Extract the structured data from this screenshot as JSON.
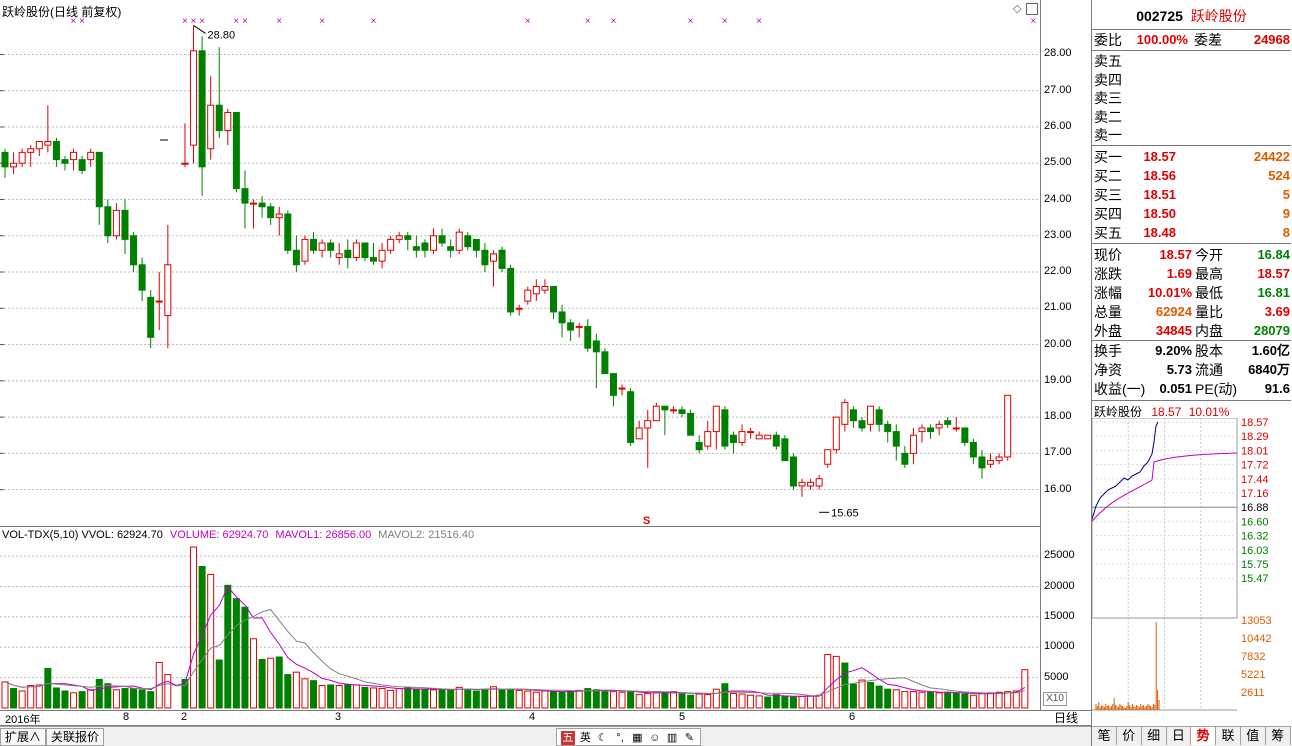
{
  "kline": {
    "title": "跃岭股份(日线 前复权)",
    "high_label": "28.80",
    "low_label": "15.65",
    "s_marker": "S",
    "price_ticks": [
      "28.00",
      "27.00",
      "26.00",
      "25.00",
      "24.00",
      "23.00",
      "22.00",
      "21.00",
      "20.00",
      "19.00",
      "18.00",
      "17.00",
      "16.00"
    ],
    "axis_min": 15.3,
    "axis_max": 28.95,
    "candles": [
      [
        25.3,
        25.4,
        24.6,
        24.9
      ],
      [
        24.9,
        25.3,
        24.7,
        25.0
      ],
      [
        25.0,
        25.4,
        24.9,
        25.3
      ],
      [
        25.3,
        25.5,
        24.9,
        25.4
      ],
      [
        25.4,
        25.6,
        25.2,
        25.6
      ],
      [
        25.5,
        26.6,
        25.3,
        25.6
      ],
      [
        25.6,
        25.7,
        24.9,
        25.1
      ],
      [
        25.1,
        25.2,
        24.8,
        25.0
      ],
      [
        25.1,
        25.4,
        24.8,
        25.3
      ],
      [
        25.1,
        25.2,
        24.7,
        24.8
      ],
      [
        25.1,
        25.4,
        24.9,
        25.3
      ],
      [
        25.3,
        25.3,
        23.3,
        23.8
      ],
      [
        23.8,
        24.0,
        22.8,
        23.0
      ],
      [
        23.0,
        23.9,
        22.9,
        23.7
      ],
      [
        23.7,
        24.0,
        22.5,
        22.9
      ],
      [
        23.0,
        23.1,
        22.0,
        22.2
      ],
      [
        22.2,
        22.4,
        21.2,
        21.5
      ],
      [
        21.3,
        21.5,
        19.9,
        20.2
      ],
      [
        21.2,
        22.0,
        20.4,
        21.2
      ],
      [
        20.8,
        23.3,
        19.9,
        22.2
      ],
      [
        null,
        null,
        null,
        null
      ],
      [
        25.0,
        26.1,
        24.9,
        25.0
      ],
      [
        25.5,
        28.8,
        25.0,
        28.1
      ],
      [
        28.1,
        28.5,
        24.1,
        24.9
      ],
      [
        25.4,
        27.4,
        25.1,
        26.6
      ],
      [
        26.6,
        28.2,
        25.7,
        25.9
      ],
      [
        25.9,
        26.5,
        25.5,
        26.4
      ],
      [
        26.4,
        26.4,
        24.2,
        24.3
      ],
      [
        24.3,
        24.8,
        23.2,
        23.9
      ],
      [
        23.9,
        24.0,
        23.2,
        23.9
      ],
      [
        23.9,
        24.1,
        23.5,
        23.8
      ],
      [
        23.8,
        23.9,
        23.3,
        23.5
      ],
      [
        23.5,
        23.8,
        23.0,
        23.6
      ],
      [
        23.6,
        23.7,
        22.5,
        22.6
      ],
      [
        22.6,
        23.0,
        22.0,
        22.2
      ],
      [
        22.3,
        23.0,
        22.2,
        22.9
      ],
      [
        22.9,
        23.1,
        22.5,
        22.6
      ],
      [
        22.6,
        22.9,
        22.4,
        22.8
      ],
      [
        22.8,
        22.9,
        22.4,
        22.6
      ],
      [
        22.4,
        22.8,
        22.2,
        22.5
      ],
      [
        22.6,
        22.9,
        22.1,
        22.4
      ],
      [
        22.4,
        22.9,
        22.3,
        22.8
      ],
      [
        22.8,
        22.8,
        22.3,
        22.4
      ],
      [
        22.4,
        22.8,
        22.2,
        22.3
      ],
      [
        22.3,
        22.8,
        22.1,
        22.6
      ],
      [
        22.6,
        23.0,
        22.5,
        22.9
      ],
      [
        22.9,
        23.1,
        22.8,
        23.0
      ],
      [
        23.0,
        23.1,
        22.6,
        22.9
      ],
      [
        22.7,
        23.0,
        22.4,
        22.6
      ],
      [
        22.8,
        22.9,
        22.4,
        22.6
      ],
      [
        22.6,
        23.2,
        22.5,
        23.0
      ],
      [
        23.0,
        23.2,
        22.7,
        22.8
      ],
      [
        22.7,
        22.9,
        22.4,
        22.6
      ],
      [
        22.6,
        23.2,
        22.5,
        23.1
      ],
      [
        23.0,
        23.1,
        22.6,
        22.7
      ],
      [
        22.9,
        22.9,
        22.4,
        22.6
      ],
      [
        22.6,
        22.8,
        22.0,
        22.2
      ],
      [
        22.3,
        22.6,
        21.6,
        22.5
      ],
      [
        22.6,
        22.7,
        22.0,
        22.1
      ],
      [
        22.1,
        22.2,
        20.8,
        20.9
      ],
      [
        21.0,
        21.1,
        20.8,
        21.0
      ],
      [
        21.2,
        21.6,
        21.1,
        21.5
      ],
      [
        21.4,
        21.8,
        21.2,
        21.6
      ],
      [
        21.5,
        21.8,
        21.4,
        21.6
      ],
      [
        21.6,
        21.6,
        20.7,
        20.9
      ],
      [
        20.9,
        21.1,
        20.2,
        20.6
      ],
      [
        20.6,
        20.7,
        20.1,
        20.4
      ],
      [
        20.5,
        20.6,
        20.2,
        20.5
      ],
      [
        20.5,
        20.7,
        19.8,
        19.9
      ],
      [
        20.1,
        20.3,
        18.8,
        19.8
      ],
      [
        19.8,
        19.9,
        19.2,
        19.2
      ],
      [
        19.2,
        19.2,
        18.3,
        18.6
      ],
      [
        18.8,
        18.9,
        18.6,
        18.8
      ],
      [
        18.7,
        18.8,
        17.2,
        17.3
      ],
      [
        17.4,
        17.9,
        17.4,
        17.7
      ],
      [
        17.7,
        18.2,
        16.6,
        17.9
      ],
      [
        17.9,
        18.4,
        17.9,
        18.3
      ],
      [
        18.3,
        18.3,
        17.5,
        18.2
      ],
      [
        18.2,
        18.3,
        18.1,
        18.2
      ],
      [
        18.2,
        18.3,
        18.0,
        18.1
      ],
      [
        18.1,
        18.2,
        17.5,
        17.5
      ],
      [
        17.3,
        17.5,
        17.0,
        17.1
      ],
      [
        17.2,
        17.9,
        17.1,
        17.6
      ],
      [
        17.6,
        18.3,
        17.1,
        18.3
      ],
      [
        18.2,
        18.3,
        17.1,
        17.2
      ],
      [
        17.5,
        17.6,
        17.0,
        17.3
      ],
      [
        17.3,
        17.8,
        17.2,
        17.6
      ],
      [
        17.6,
        17.7,
        17.4,
        17.6
      ],
      [
        17.4,
        17.6,
        17.4,
        17.5
      ],
      [
        17.4,
        17.5,
        17.4,
        17.5
      ],
      [
        17.5,
        17.6,
        17.1,
        17.2
      ],
      [
        17.4,
        17.5,
        16.8,
        16.8
      ],
      [
        16.9,
        17.0,
        16.0,
        16.1
      ],
      [
        16.1,
        16.3,
        15.8,
        16.2
      ],
      [
        16.1,
        16.3,
        16.0,
        16.2
      ],
      [
        16.1,
        16.4,
        16.0,
        16.3
      ],
      [
        16.7,
        17.1,
        16.6,
        17.1
      ],
      [
        17.1,
        18.0,
        17.0,
        18.0
      ],
      [
        17.8,
        18.5,
        17.6,
        18.4
      ],
      [
        18.2,
        18.3,
        17.7,
        17.9
      ],
      [
        17.9,
        18.0,
        17.6,
        17.7
      ],
      [
        17.8,
        18.3,
        17.6,
        18.3
      ],
      [
        18.2,
        18.3,
        17.6,
        17.8
      ],
      [
        17.8,
        17.9,
        17.3,
        17.6
      ],
      [
        17.6,
        17.8,
        16.8,
        17.2
      ],
      [
        17.0,
        17.2,
        16.6,
        16.7
      ],
      [
        17.0,
        17.7,
        16.7,
        17.5
      ],
      [
        17.6,
        17.8,
        17.3,
        17.7
      ],
      [
        17.7,
        17.8,
        17.4,
        17.6
      ],
      [
        17.7,
        17.9,
        17.5,
        17.8
      ],
      [
        17.9,
        18.0,
        17.7,
        17.8
      ],
      [
        17.7,
        18.0,
        17.6,
        17.7
      ],
      [
        17.7,
        17.7,
        17.2,
        17.3
      ],
      [
        17.3,
        17.4,
        16.7,
        16.9
      ],
      [
        16.9,
        17.1,
        16.3,
        16.6
      ],
      [
        16.7,
        17.0,
        16.6,
        16.8
      ],
      [
        16.8,
        17.0,
        16.7,
        16.9
      ],
      [
        16.9,
        18.6,
        16.8,
        18.6
      ]
    ],
    "marker_indices": [
      8,
      9,
      21,
      22,
      23,
      27,
      28,
      32,
      37,
      43,
      61,
      68,
      71,
      80,
      84,
      88,
      120
    ]
  },
  "volume": {
    "label_main": "VOL-TDX(5,10)",
    "label_vvol": "VVOL: 62924.70",
    "label_volume": "VOLUME: 62924.70",
    "label_mavol1": "MAVOL1: 26856.00",
    "label_mavol2": "MAVOL2: 21516.40",
    "ticks": [
      "25000",
      "20000",
      "15000",
      "10000",
      "5000"
    ],
    "x10_label": "X10",
    "axis_max": 27500,
    "values": [
      4300,
      3200,
      2800,
      3700,
      3800,
      6500,
      3300,
      2800,
      2500,
      2700,
      3000,
      4700,
      4000,
      3000,
      3200,
      3200,
      3000,
      2700,
      7500,
      5500,
      0,
      4700,
      26500,
      23300,
      22000,
      7900,
      20200,
      18000,
      16600,
      11400,
      8000,
      8200,
      8400,
      5500,
      5900,
      4800,
      4500,
      3700,
      3800,
      3700,
      3900,
      3800,
      3400,
      3300,
      3200,
      2900,
      3200,
      3300,
      3100,
      3100,
      3000,
      3000,
      2900,
      3400,
      3100,
      2800,
      3100,
      3500,
      3000,
      3100,
      2900,
      2800,
      2600,
      2800,
      2700,
      2600,
      2800,
      2900,
      3200,
      3000,
      2800,
      2700,
      2600,
      2800,
      2200,
      2400,
      2500,
      2600,
      2700,
      2300,
      2100,
      2300,
      2200,
      3100,
      4000,
      2400,
      2300,
      2100,
      2000,
      1800,
      2200,
      1900,
      1800,
      1900,
      2000,
      2100,
      8800,
      8500,
      7400,
      3900,
      4600,
      4200,
      3600,
      3100,
      3000,
      2700,
      2700,
      2600,
      2600,
      2500,
      2600,
      2400,
      2300,
      2100,
      2400,
      2500,
      2600,
      2700,
      2800,
      6300
    ],
    "colors_up": [
      1,
      0,
      1,
      1,
      1,
      0,
      0,
      0,
      1,
      0,
      1,
      0,
      0,
      1,
      0,
      0,
      0,
      0,
      1,
      1,
      0,
      0,
      1,
      0,
      1,
      0,
      0,
      0,
      0,
      1,
      0,
      1,
      0,
      0,
      1,
      1,
      0,
      1,
      0,
      1,
      0,
      1,
      0,
      1,
      1,
      1,
      1,
      0,
      0,
      0,
      1,
      0,
      0,
      1,
      0,
      0,
      0,
      1,
      0,
      0,
      1,
      1,
      1,
      1,
      0,
      0,
      0,
      1,
      0,
      0,
      0,
      1,
      1,
      0,
      1,
      1,
      1,
      0,
      1,
      0,
      0,
      1,
      1,
      1,
      0,
      1,
      1,
      1,
      1,
      0,
      0,
      0,
      0,
      1,
      1,
      1,
      1,
      1,
      0,
      0,
      1,
      0,
      0,
      0,
      1,
      1,
      1,
      1,
      0,
      1,
      0,
      0,
      0,
      1,
      1,
      1,
      1,
      1,
      1,
      1,
      1
    ]
  },
  "dates": [
    "2016年",
    "8",
    "2",
    "3",
    "4",
    "5",
    "6"
  ],
  "bottom_tabs": [
    "扩展∧",
    "关联报价"
  ],
  "right": {
    "code": "002725",
    "name": "跃岭股份",
    "weibi_label": "委比",
    "weibi": "100.00%",
    "weicha_label": "委差",
    "weicha": "24968",
    "asks": [
      {
        "label": "卖五"
      },
      {
        "label": "卖四"
      },
      {
        "label": "卖三"
      },
      {
        "label": "卖二"
      },
      {
        "label": "卖一"
      }
    ],
    "bids": [
      {
        "label": "买一",
        "price": "18.57",
        "vol": "24422"
      },
      {
        "label": "买二",
        "price": "18.56",
        "vol": "524"
      },
      {
        "label": "买三",
        "price": "18.51",
        "vol": "5"
      },
      {
        "label": "买四",
        "price": "18.50",
        "vol": "9"
      },
      {
        "label": "买五",
        "price": "18.48",
        "vol": "8"
      }
    ],
    "stats": [
      {
        "l1": "现价",
        "v1": "18.57",
        "c1": "red",
        "l2": "今开",
        "v2": "16.84",
        "c2": "green"
      },
      {
        "l1": "涨跌",
        "v1": "1.69",
        "c1": "red",
        "l2": "最高",
        "v2": "18.57",
        "c2": "red"
      },
      {
        "l1": "涨幅",
        "v1": "10.01%",
        "c1": "red",
        "l2": "最低",
        "v2": "16.81",
        "c2": "green"
      },
      {
        "l1": "总量",
        "v1": "62924",
        "c1": "orange",
        "l2": "量比",
        "v2": "3.69",
        "c2": "red"
      },
      {
        "l1": "外盘",
        "v1": "34845",
        "c1": "red",
        "l2": "内盘",
        "v2": "28079",
        "c2": "green"
      }
    ],
    "stats2": [
      {
        "l1": "换手",
        "v1": "9.20%",
        "l2": "股本",
        "v2": "1.60亿"
      },
      {
        "l1": "净资",
        "v1": "5.73",
        "l2": "流通",
        "v2": "6840万"
      },
      {
        "l1": "收益(一)",
        "v1": "0.051",
        "l2": "PE(动)",
        "v2": "91.6"
      }
    ],
    "mini_title": "跃岭股份",
    "mini_price": "18.57",
    "mini_pct": "10.01%",
    "mini_ticks": [
      "18.57",
      "18.29",
      "18.01",
      "17.72",
      "17.44",
      "17.16",
      "16.88",
      "16.60",
      "16.32",
      "16.03",
      "15.75",
      "15.47"
    ],
    "mini_vol_ticks": [
      "13053",
      "10442",
      "7832",
      "5221",
      "2611"
    ],
    "tabs": [
      "笔",
      "价",
      "细",
      "日",
      "势",
      "联",
      "值",
      "筹"
    ],
    "active_tab": "势"
  },
  "colors": {
    "up": "#e00000",
    "down": "#008000",
    "ma1": "#c000c0",
    "ma2": "#808080",
    "avg": "#c000c0",
    "price": "#000080"
  }
}
